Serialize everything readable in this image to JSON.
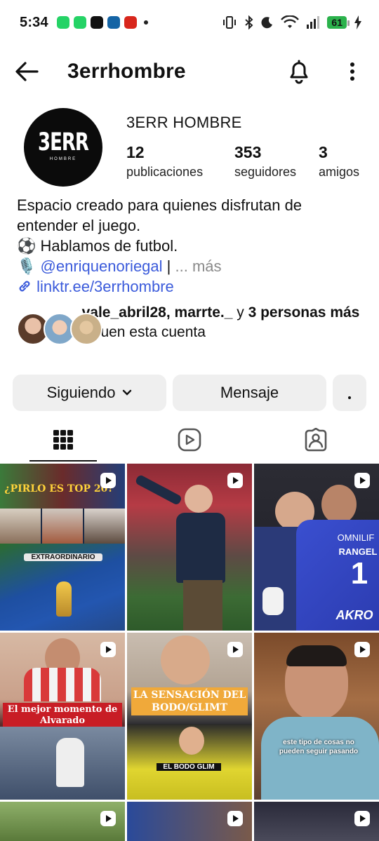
{
  "status": {
    "time": "5:34",
    "battery": "61"
  },
  "header": {
    "username": "3errhombre"
  },
  "profile": {
    "logo_text": "3ERR",
    "logo_sub": "HOMBRE",
    "display_name": "3ERR HOMBRE",
    "stats": [
      {
        "value": "12",
        "label": "publicaciones"
      },
      {
        "value": "353",
        "label": "seguidores"
      },
      {
        "value": "3",
        "label": "amigos"
      }
    ],
    "bio_line1": "Espacio creado para quienes disfrutan de",
    "bio_line2": "entender el juego.",
    "bio_line3_emoji": "⚽",
    "bio_line3": "Hablamos de futbol.",
    "bio_line4_emoji": "🎙️",
    "bio_mention": "@enriquenoriegal",
    "bio_sep": "|",
    "bio_more": "... más",
    "link": "linktr.ee/3errhombre"
  },
  "followed_by": {
    "names": "vale_abril28, marrte._",
    "connector": "y",
    "others": "3 personas más",
    "suffix": "siguen esta cuenta"
  },
  "buttons": {
    "following": "Siguiendo",
    "message": "Mensaje"
  },
  "posts": {
    "p1_title": "¿PIRLO ES TOP 20?",
    "p1_badge": "EXTRAORDINARIO",
    "p4_caption": "El mejor momento de Alvarado",
    "p5_caption": "LA SENSACIÓN DEL BODO/GLIMT",
    "p5_badge": "EL BODO GLIM",
    "p6_caption": "este tipo de cosas no pueden seguir pasando",
    "p3_jersey_name": "RANGEL",
    "p3_jersey_brand": "OMNILIF",
    "p3_jersey_num": "1",
    "p3_sponsor": "AKRO"
  },
  "colors": {
    "link": "#3b5bdb",
    "button_bg": "#efefef",
    "battery": "#2bb24c"
  },
  "icons": {
    "back": "arrow-left-icon",
    "bell": "bell-icon",
    "more": "more-vertical-icon",
    "grid": "grid-icon",
    "reels": "reels-icon",
    "tagged": "tagged-icon",
    "link": "link-icon"
  }
}
